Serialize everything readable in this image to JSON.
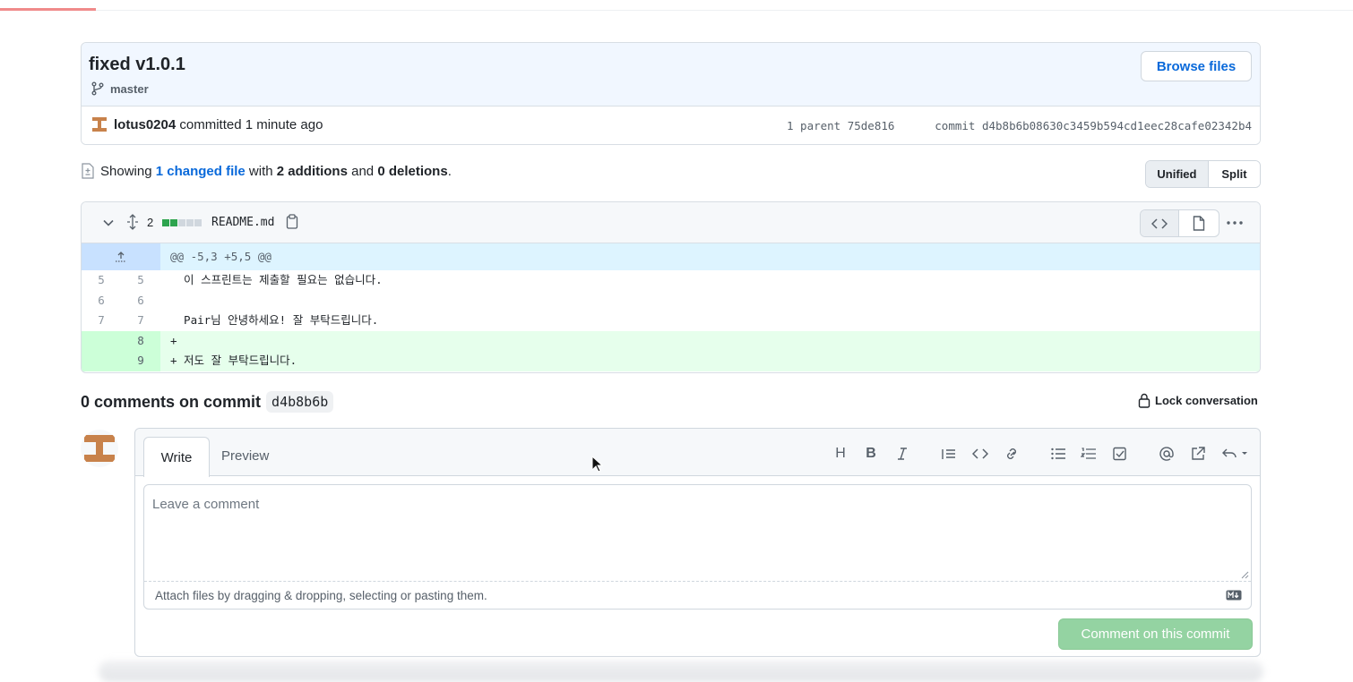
{
  "commit": {
    "title": "fixed v1.0.1",
    "branch": "master",
    "browse_label": "Browse files",
    "author": "lotus0204",
    "action": " committed 1 minute ago",
    "parent_label": "1 parent ",
    "parent_sha": "75de816",
    "commit_label": "commit ",
    "sha": "d4b8b6b08630c3459b594cd1eec28cafe02342b4"
  },
  "summary": {
    "prefix": "Showing ",
    "changed": "1 changed file",
    "mid": " with ",
    "additions": "2 additions",
    "and": " and ",
    "deletions": "0 deletions",
    "end": "."
  },
  "view_toggle": {
    "unified": "Unified",
    "split": "Split"
  },
  "diff": {
    "count": "2",
    "filename": "README.md",
    "hunk": "@@ -5,3 +5,5 @@",
    "rows": [
      {
        "old": "5",
        "new": "5",
        "text": "  이 스프린트는 제출할 필요는 없습니다."
      },
      {
        "old": "6",
        "new": "6",
        "text": ""
      },
      {
        "old": "7",
        "new": "7",
        "text": "  Pair님 안녕하세요! 잘 부탁드립니다."
      },
      {
        "old": "",
        "new": "8",
        "text": "+"
      },
      {
        "old": "",
        "new": "9",
        "text": "+ 저도 잘 부탁드립니다."
      }
    ],
    "add_color": "#2da44e",
    "neutral_color": "#d0d7de"
  },
  "comments": {
    "count_label": "0 comments on commit",
    "short_sha": "d4b8b6b",
    "lock_label": "Lock conversation"
  },
  "form": {
    "tab_write": "Write",
    "tab_preview": "Preview",
    "placeholder": "Leave a comment",
    "attach_hint": "Attach files by dragging & dropping, selecting or pasting them.",
    "submit_label": "Comment on this commit",
    "toolbar_icons": [
      "heading-icon",
      "bold-icon",
      "italic-icon",
      "quote-icon",
      "code-icon",
      "link-icon",
      "unordered-list-icon",
      "ordered-list-icon",
      "task-list-icon",
      "mention-icon",
      "reference-icon",
      "reply-icon"
    ]
  }
}
